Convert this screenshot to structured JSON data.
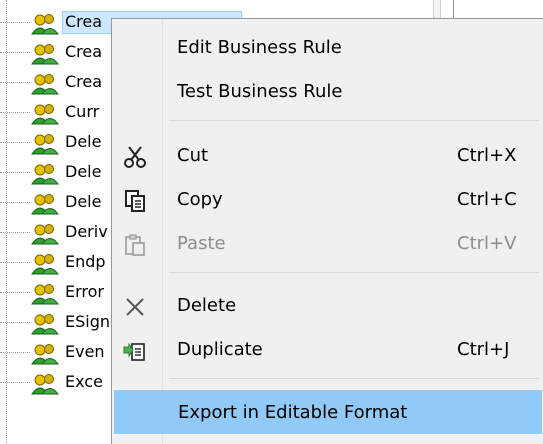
{
  "tree": {
    "items": [
      {
        "label": "Crea"
      },
      {
        "label": "Crea"
      },
      {
        "label": "Crea"
      },
      {
        "label": "Curr"
      },
      {
        "label": "Dele"
      },
      {
        "label": "Dele"
      },
      {
        "label": "Dele"
      },
      {
        "label": "Deriv"
      },
      {
        "label": "Endp"
      },
      {
        "label": "Error"
      },
      {
        "label": "ESign"
      },
      {
        "label": "Even"
      },
      {
        "label": "Exce"
      }
    ],
    "icon": "business-rule-people-icon"
  },
  "context_menu": {
    "items": [
      {
        "label": "Edit Business Rule",
        "shortcut": "",
        "icon": "",
        "enabled": true
      },
      {
        "label": "Test Business Rule",
        "shortcut": "",
        "icon": "",
        "enabled": true
      },
      {
        "label": "Cut",
        "shortcut": "Ctrl+X",
        "icon": "scissors-icon",
        "enabled": true
      },
      {
        "label": "Copy",
        "shortcut": "Ctrl+C",
        "icon": "copy-icon",
        "enabled": true
      },
      {
        "label": "Paste",
        "shortcut": "Ctrl+V",
        "icon": "paste-icon",
        "enabled": false
      },
      {
        "label": "Delete",
        "shortcut": "",
        "icon": "delete-x-icon",
        "enabled": true
      },
      {
        "label": "Duplicate",
        "shortcut": "Ctrl+J",
        "icon": "duplicate-icon",
        "enabled": true
      },
      {
        "label": "Export in Editable Format",
        "shortcut": "",
        "icon": "",
        "enabled": true,
        "highlighted": true
      }
    ]
  },
  "colors": {
    "highlight": "#91c9f7",
    "selection": "#cce8ff",
    "menu_bg": "#f0f0f0",
    "disabled_text": "#8d8d8d"
  }
}
